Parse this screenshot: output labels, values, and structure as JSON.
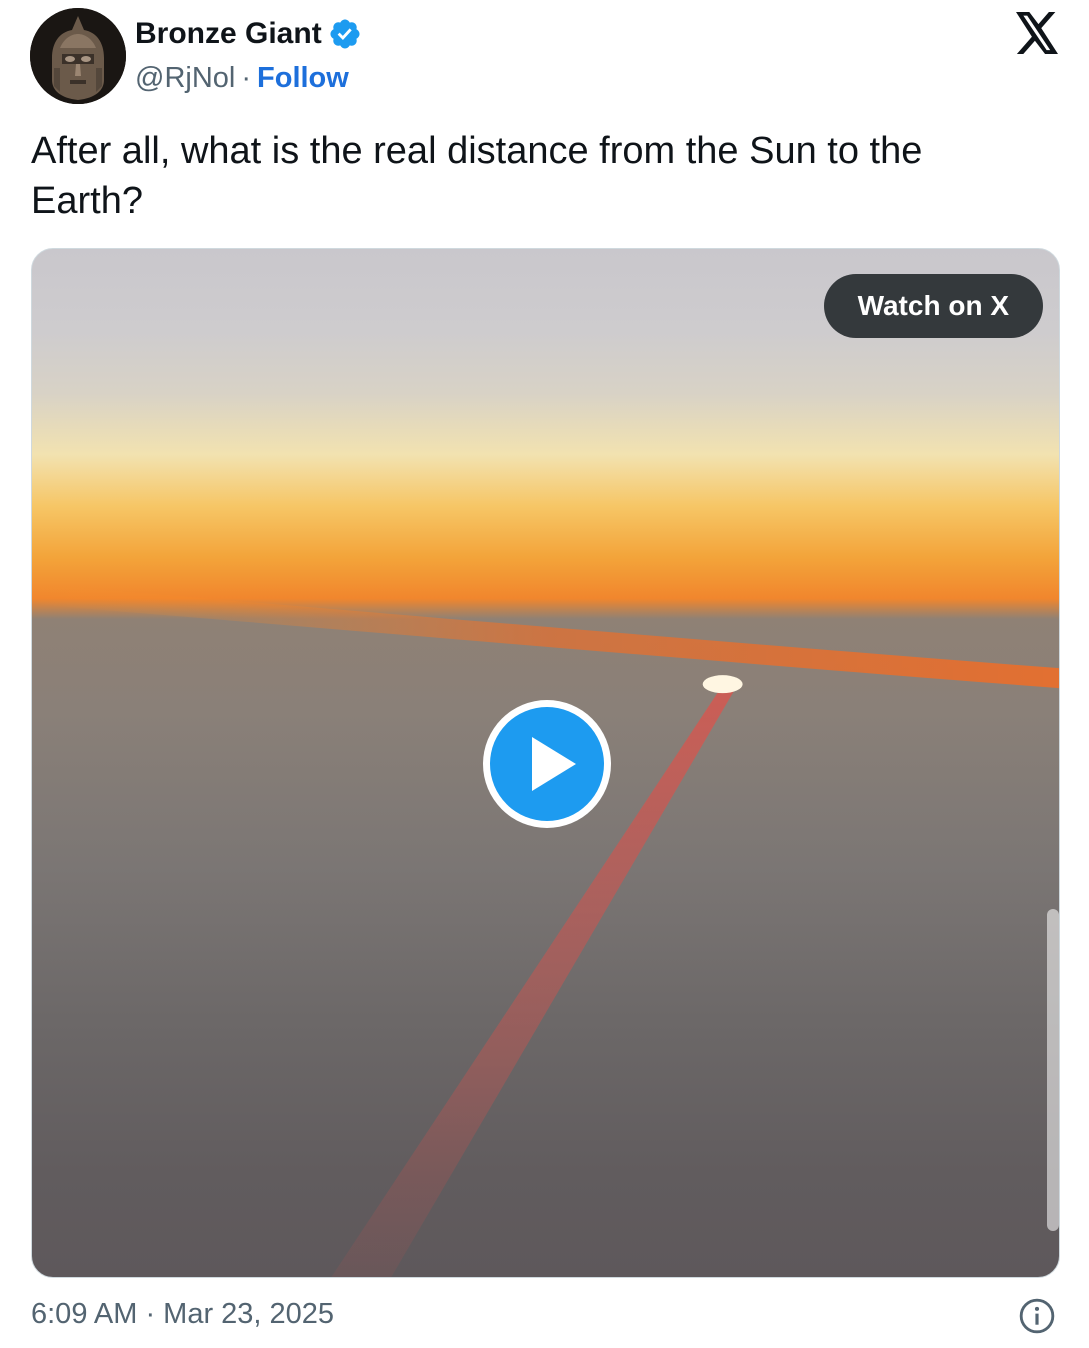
{
  "author": {
    "name": "Bronze Giant",
    "handle": "@RjNol",
    "separator": "·",
    "follow_label": "Follow",
    "verified": true,
    "avatar_icon": "bronze-helmet-statue-avatar"
  },
  "platform": {
    "logo_icon": "x-logo-icon"
  },
  "tweet": {
    "text": "After all, what is the real distance from the Sun to the Earth?"
  },
  "media": {
    "type": "video",
    "watch_label": "Watch on X",
    "play_icon": "play-icon",
    "accent_color": "#1d9bf0"
  },
  "footer": {
    "timestamp": "6:09 AM · Mar 23, 2025",
    "info_icon": "info-icon"
  },
  "colors": {
    "follow_link": "#1d6fdb",
    "verified_badge": "#1d9bf0",
    "muted_text": "#536471"
  }
}
